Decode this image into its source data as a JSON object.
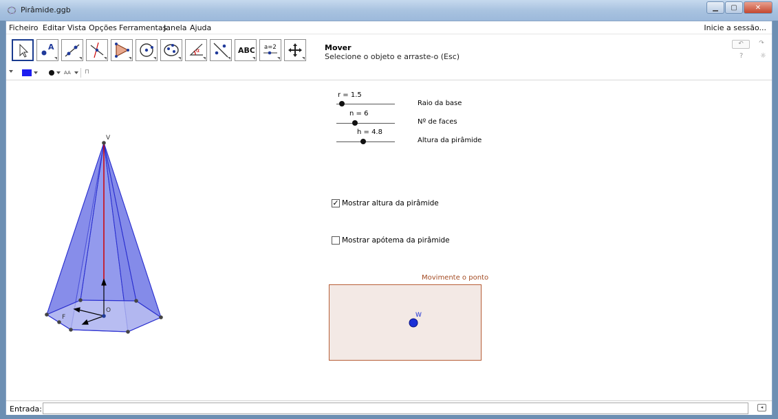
{
  "window": {
    "title": "Pirâmide.ggb"
  },
  "menu": {
    "items": [
      "Ficheiro",
      "Editar",
      "Vista",
      "Opções",
      "Ferramentas",
      "Janela",
      "Ajuda"
    ],
    "login": "Inicie a sessão..."
  },
  "toolbar": {
    "active_tool_name": "Mover",
    "active_tool_help": "Selecione o objeto e arraste-o (Esc)",
    "tools": [
      "move",
      "point",
      "line",
      "perpendicular-line",
      "polygon",
      "circle",
      "conic",
      "angle",
      "reflect",
      "text",
      "slider",
      "move-graphics-view"
    ],
    "text_tool_label": "ABC",
    "slider_tool_label": "a=2",
    "help_icon": "?"
  },
  "sliders": [
    {
      "label": "r = 1.5",
      "caption": "Raio da base",
      "value": 1.5
    },
    {
      "label": "n = 6",
      "caption": "Nº de faces",
      "value": 6
    },
    {
      "label": "h = 4.8",
      "caption": "Altura da pirâmide",
      "value": 4.8
    }
  ],
  "checkboxes": [
    {
      "label": "Mostrar altura da pirâmide",
      "checked": true
    },
    {
      "label": "Mostrar apótema da pirâmide",
      "checked": false
    }
  ],
  "move_area": {
    "title": "Movimente o ponto",
    "point_label": "W"
  },
  "pyramid": {
    "apex_label": "V",
    "center_label": "O",
    "foot_label": "F"
  },
  "input_bar": {
    "label": "Entrada:",
    "value": ""
  },
  "colors": {
    "face_fill": "#6f77e6",
    "height_line": "#d00000",
    "move_border": "#b65c34",
    "move_fill": "#f3e9e5",
    "point_w": "#1a2fd6"
  }
}
